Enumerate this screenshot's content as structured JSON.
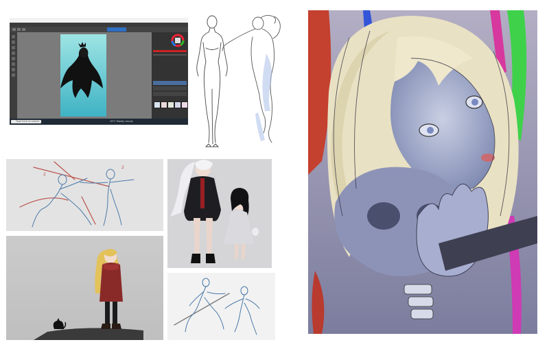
{
  "krita_window": {
    "title": "",
    "taskbar_search": "Type here to search",
    "weather": "19°C Mostly cloudy"
  },
  "panels": [
    {
      "key": "krita",
      "description_icon": "painting-app-screenshot"
    },
    {
      "key": "figures",
      "description_icon": "figure-sketch"
    },
    {
      "key": "portrait",
      "description_icon": "illustration"
    },
    {
      "key": "fight",
      "description_icon": "gesture-sketch"
    },
    {
      "key": "couple",
      "description_icon": "character-render"
    },
    {
      "key": "girl",
      "description_icon": "character-illustration"
    },
    {
      "key": "swords",
      "description_icon": "gesture-sketch"
    }
  ],
  "colors": {
    "krita_bg": "#5a5a5a",
    "canvas_teal": "#6ccfd2",
    "portrait_bg": "#8f8aa6",
    "hair_blonde": "#e8dfbf",
    "skin_grey": "#9aa3c4",
    "sketch_blue": "#4a79a8",
    "sketch_red": "#b9524c",
    "coat_red": "#8a2a28"
  }
}
